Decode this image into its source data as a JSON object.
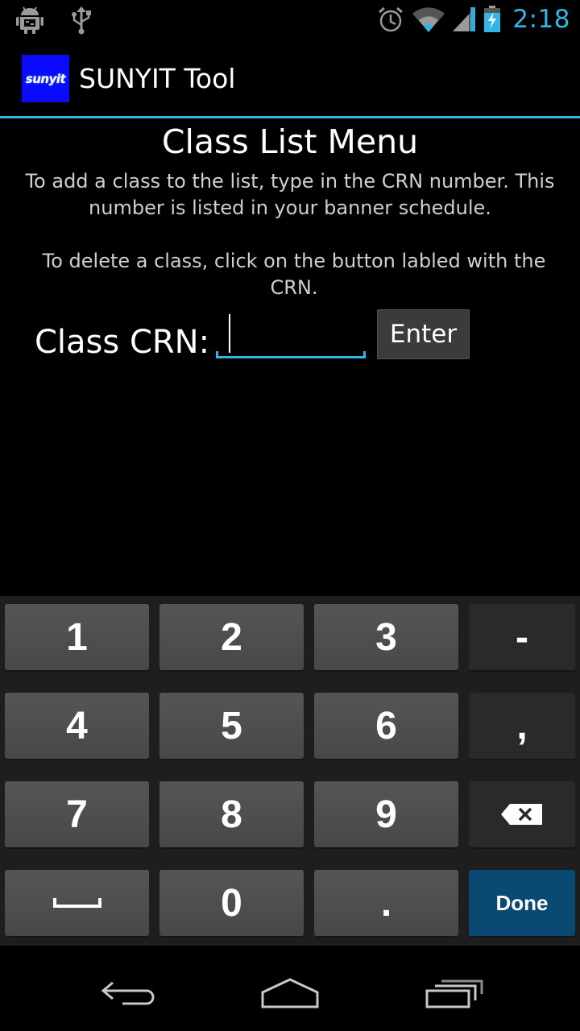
{
  "status_bar": {
    "time": "2:18",
    "icons": [
      "android-debug-icon",
      "usb-icon",
      "alarm-icon",
      "wifi-icon",
      "signal-icon",
      "battery-charging-icon"
    ]
  },
  "action_bar": {
    "logo_text": "sunyit",
    "title": "SUNYIT Tool"
  },
  "main": {
    "title": "Class List Menu",
    "description_add": "To add a class to the list, type in the CRN number. This number is listed in your banner schedule.",
    "description_delete": "To delete a class, click on the button labled with the CRN.",
    "crn_label": "Class CRN:",
    "crn_value": "",
    "enter_label": "Enter"
  },
  "keyboard": {
    "rows": [
      [
        "1",
        "2",
        "3",
        "-"
      ],
      [
        "4",
        "5",
        "6",
        ","
      ],
      [
        "7",
        "8",
        "9",
        "backspace"
      ],
      [
        "space",
        "0",
        ".",
        "Done"
      ]
    ],
    "done_label": "Done"
  },
  "navigation": {
    "icons": [
      "back-icon",
      "home-icon",
      "recent-apps-icon"
    ]
  },
  "colors": {
    "accent": "#33b5e5",
    "background": "#000000",
    "key": "#4f4f4f",
    "done_key": "#0a4a72"
  }
}
